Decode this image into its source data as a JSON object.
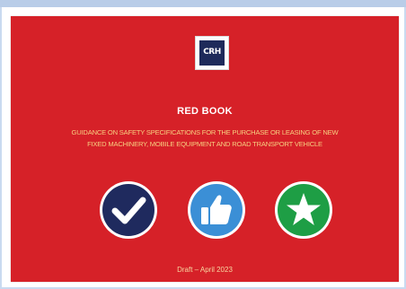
{
  "document": {
    "logo_text": "CRH",
    "title": "RED BOOK",
    "subtitle_line1": "GUIDANCE ON SAFETY SPECIFICATIONS FOR THE PURCHASE OR LEASING OF NEW",
    "subtitle_line2": "FIXED MACHINERY, MOBILE EQUIPMENT AND ROAD TRANSPORT VEHICLE",
    "date": "Draft – April 2023",
    "icons": [
      "checkmark-icon",
      "thumbs-up-icon",
      "star-icon"
    ],
    "colors": {
      "cover_red": "#d62128",
      "checkmark_badge": "#1f2a5e",
      "thumbs_up_badge": "#3b8fd6",
      "star_badge": "#1e9e45"
    }
  }
}
